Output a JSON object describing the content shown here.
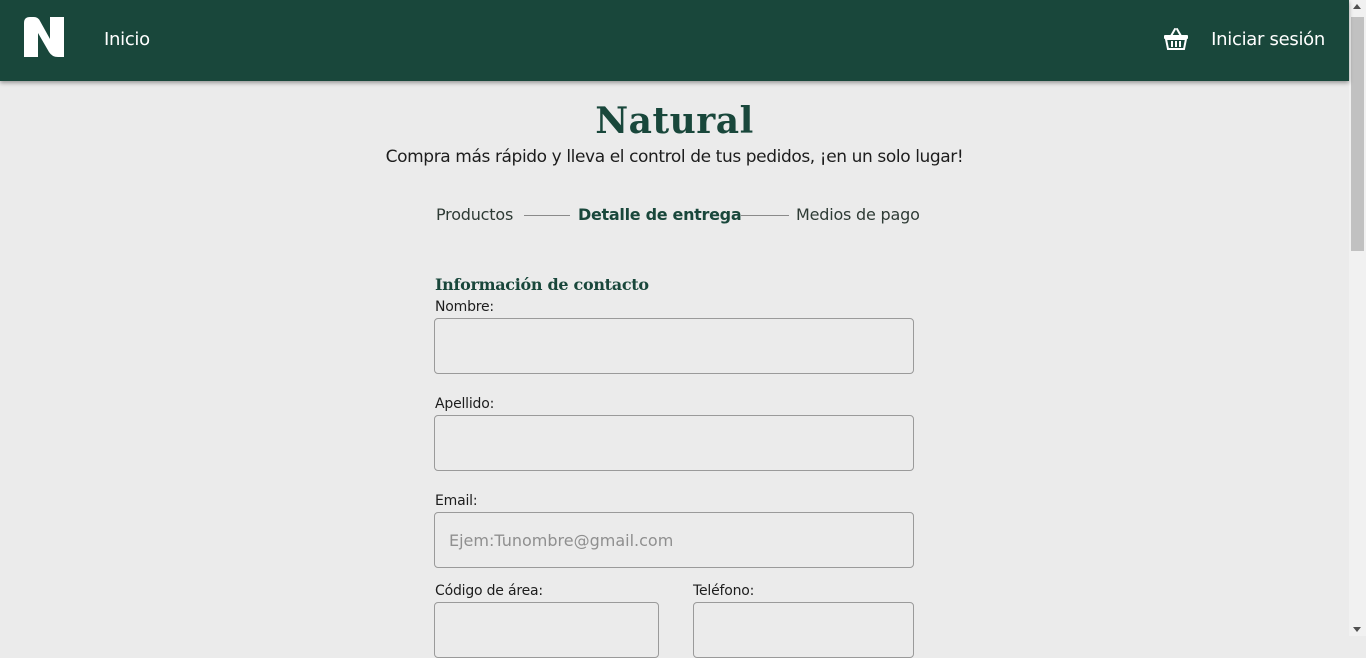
{
  "colors": {
    "brand": "#19473b",
    "background": "#ebebeb"
  },
  "header": {
    "logo_icon": "brand-n-logo",
    "home_label": "Inicio",
    "cart_icon": "basket-icon",
    "login_label": "Iniciar sesión"
  },
  "brand": {
    "title": "Natural",
    "subtitle": "Compra más rápido y lleva el control de tus pedidos, ¡en un solo lugar!"
  },
  "stepper": {
    "steps": [
      {
        "label": "Productos",
        "active": false
      },
      {
        "label": "Detalle de entrega",
        "active": true
      },
      {
        "label": "Medios de pago",
        "active": false
      }
    ]
  },
  "form": {
    "section_title": "Información de contacto",
    "fields": {
      "nombre": {
        "label": "Nombre:",
        "value": "",
        "placeholder": ""
      },
      "apellido": {
        "label": "Apellido:",
        "value": "",
        "placeholder": ""
      },
      "email": {
        "label": "Email:",
        "value": "",
        "placeholder": "Ejem:Tunombre@gmail.com"
      },
      "codigo_area": {
        "label": "Código de área:",
        "value": "",
        "placeholder": ""
      },
      "telefono": {
        "label": "Teléfono:",
        "value": "",
        "placeholder": ""
      }
    }
  }
}
